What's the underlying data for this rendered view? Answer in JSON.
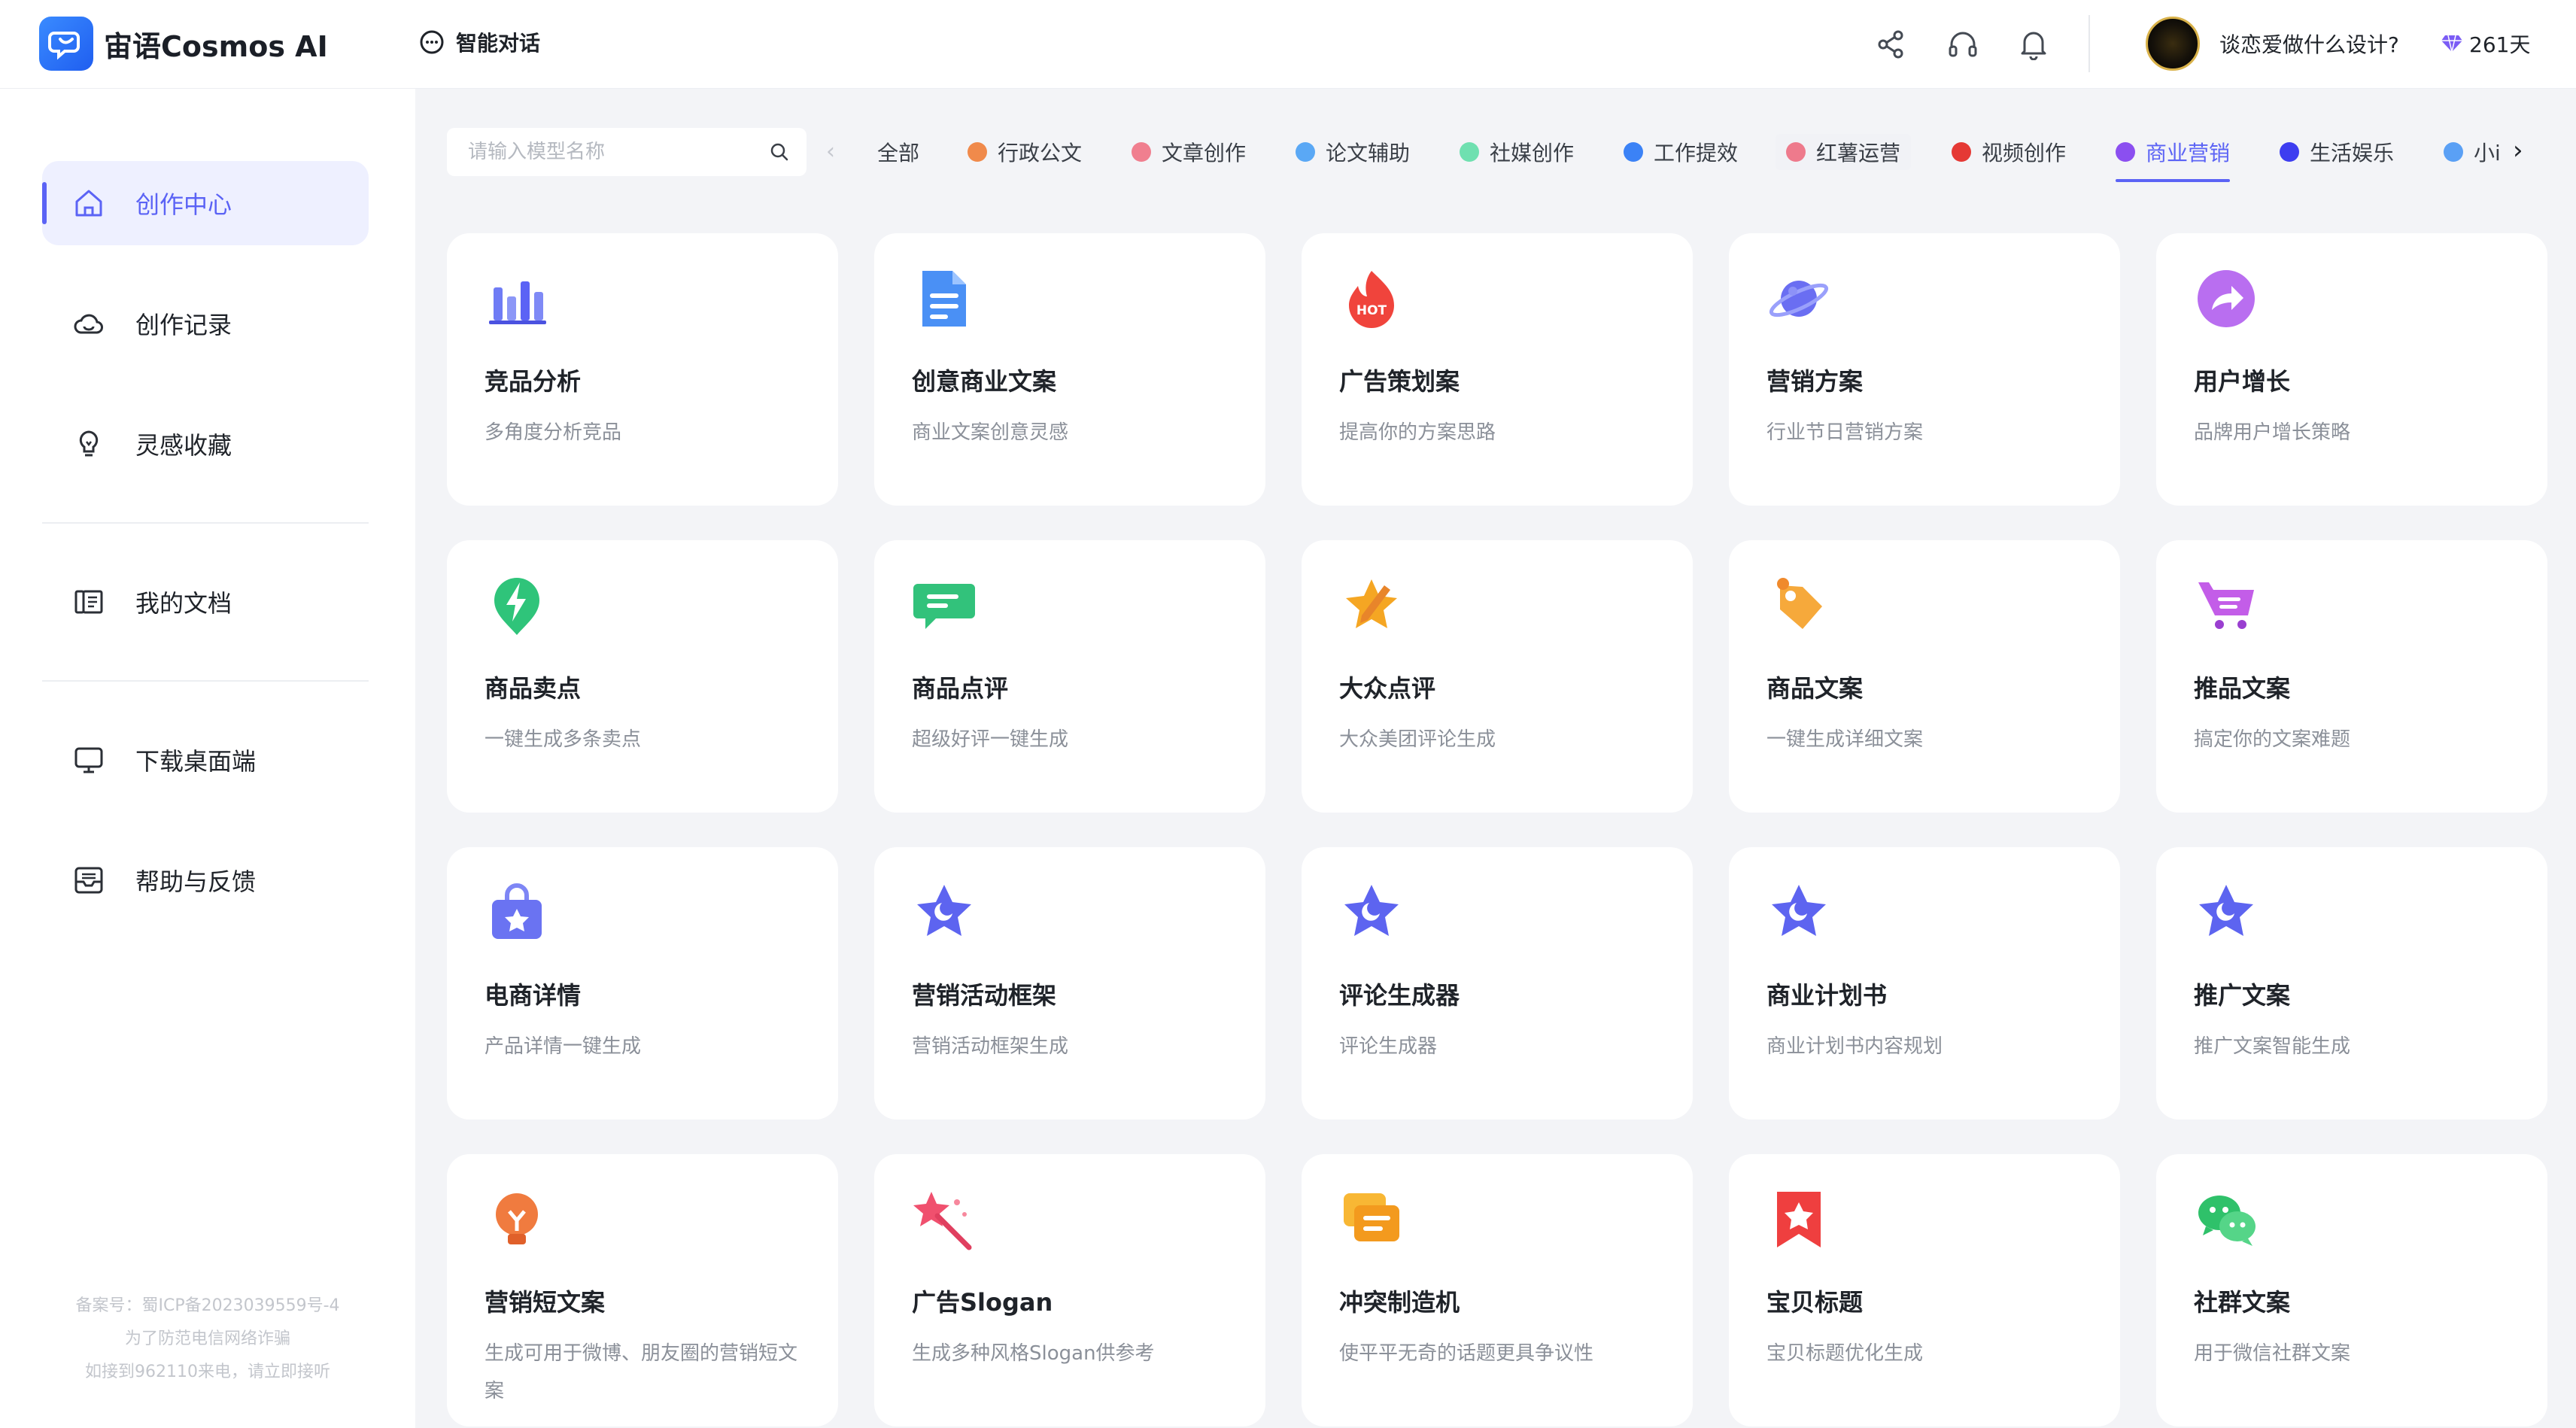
{
  "header": {
    "app_title": "宙语Cosmos AI",
    "nav_chat": "智能对话",
    "username": "谈恋爱做什么设计?",
    "vip_days": "261天"
  },
  "sidebar": {
    "items": [
      {
        "label": "创作中心",
        "icon": "home-icon"
      },
      {
        "label": "创作记录",
        "icon": "cloud-icon"
      },
      {
        "label": "灵感收藏",
        "icon": "bulb-icon"
      },
      {
        "label": "我的文档",
        "icon": "document-icon"
      },
      {
        "label": "下载桌面端",
        "icon": "monitor-icon"
      },
      {
        "label": "帮助与反馈",
        "icon": "feedback-icon"
      }
    ],
    "footer": [
      "备案号：蜀ICP备2023039559号-4",
      "为了防范电信网络诈骗",
      "如接到962110来电，请立即接听"
    ]
  },
  "filter": {
    "search_placeholder": "请输入模型名称",
    "categories": [
      {
        "label": "全部",
        "color": ""
      },
      {
        "label": "行政公文",
        "color": "#f08a4b"
      },
      {
        "label": "文章创作",
        "color": "#f07f8f"
      },
      {
        "label": "论文辅助",
        "color": "#5aa8f5"
      },
      {
        "label": "社媒创作",
        "color": "#6fe0b0"
      },
      {
        "label": "工作提效",
        "color": "#3b82f6"
      },
      {
        "label": "红薯运营",
        "color": "#ee7a8c"
      },
      {
        "label": "视频创作",
        "color": "#e53935"
      },
      {
        "label": "商业营销",
        "color": "#8b4ff0"
      },
      {
        "label": "生活娱乐",
        "color": "#3d3df0"
      },
      {
        "label": "小i",
        "color": "#5aa0f5"
      }
    ],
    "active_category": "商业营销"
  },
  "cards": [
    {
      "title": "竞品分析",
      "desc": "多角度分析竞品",
      "icon": "bar-chart-icon"
    },
    {
      "title": "创意商业文案",
      "desc": "商业文案创意灵感",
      "icon": "document-icon"
    },
    {
      "title": "广告策划案",
      "desc": "提高你的方案思路",
      "icon": "hot-flame-icon"
    },
    {
      "title": "营销方案",
      "desc": "行业节日营销方案",
      "icon": "planet-icon"
    },
    {
      "title": "用户增长",
      "desc": "品牌用户增长策略",
      "icon": "share-arrow-icon"
    },
    {
      "title": "商品卖点",
      "desc": "一键生成多条卖点",
      "icon": "lightning-pin-icon"
    },
    {
      "title": "商品点评",
      "desc": "超级好评一键生成",
      "icon": "chat-bubble-icon"
    },
    {
      "title": "大众点评",
      "desc": "大众美团评论生成",
      "icon": "star-pen-icon"
    },
    {
      "title": "商品文案",
      "desc": "一键生成详细文案",
      "icon": "product-tag-icon"
    },
    {
      "title": "推品文案",
      "desc": "搞定你的文案难题",
      "icon": "cart-icon"
    },
    {
      "title": "电商详情",
      "desc": "产品详情一键生成",
      "icon": "shopping-bag-icon"
    },
    {
      "title": "营销活动框架",
      "desc": "营销活动框架生成",
      "icon": "star-moon-icon"
    },
    {
      "title": "评论生成器",
      "desc": "评论生成器",
      "icon": "star-moon-icon"
    },
    {
      "title": "商业计划书",
      "desc": "商业计划书内容规划",
      "icon": "star-moon-icon"
    },
    {
      "title": "推广文案",
      "desc": "推广文案智能生成",
      "icon": "star-moon-icon"
    },
    {
      "title": "营销短文案",
      "desc": "生成可用于微博、朋友圈的营销短文案",
      "icon": "bulb-icon"
    },
    {
      "title": "广告Slogan",
      "desc": "生成多种风格Slogan供参考",
      "icon": "magic-wand-icon"
    },
    {
      "title": "冲突制造机",
      "desc": "使平平无奇的话题更具争议性",
      "icon": "message-icon"
    },
    {
      "title": "宝贝标题",
      "desc": "宝贝标题优化生成",
      "icon": "bookmark-icon"
    },
    {
      "title": "社群文案",
      "desc": "用于微信社群文案",
      "icon": "wechat-icon"
    }
  ]
}
